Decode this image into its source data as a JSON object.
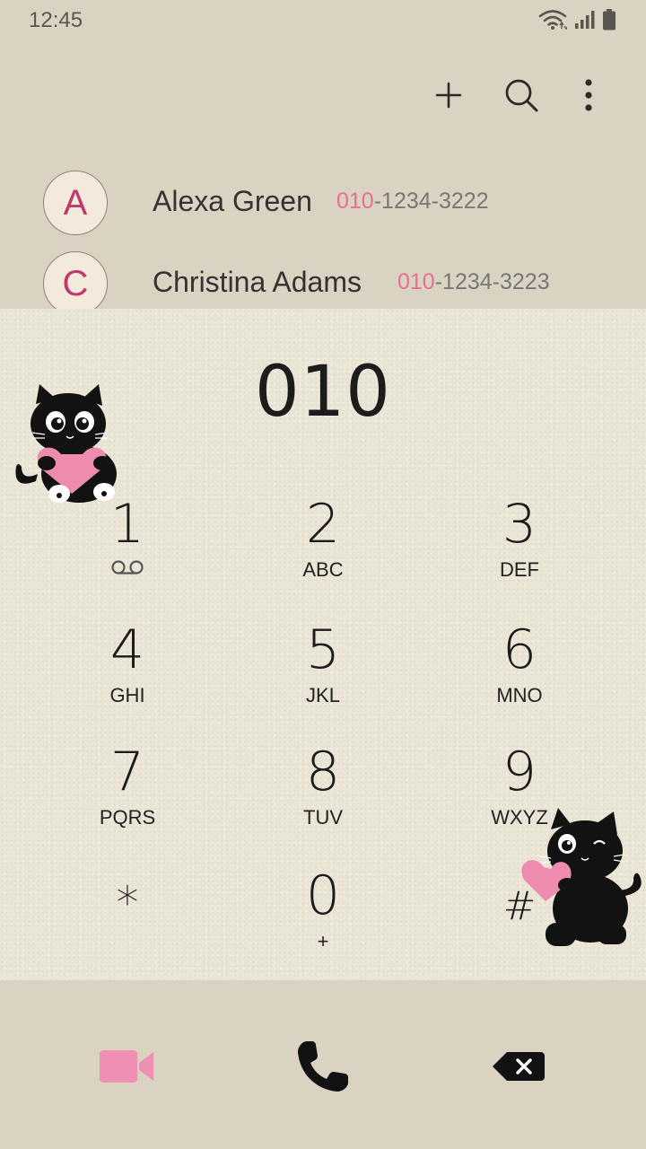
{
  "status_bar": {
    "time": "12:45"
  },
  "contacts": [
    {
      "initial": "A",
      "name": "Alexa Green",
      "number_match": "010",
      "number_rest": "-1234-3222"
    },
    {
      "initial": "C",
      "name": "Christina Adams",
      "number_match": "010",
      "number_rest": "-1234-3223"
    }
  ],
  "dialer": {
    "number": "010",
    "keys": [
      {
        "digit": "1",
        "letters": ""
      },
      {
        "digit": "2",
        "letters": "ABC"
      },
      {
        "digit": "3",
        "letters": "DEF"
      },
      {
        "digit": "4",
        "letters": "GHI"
      },
      {
        "digit": "5",
        "letters": "JKL"
      },
      {
        "digit": "6",
        "letters": "MNO"
      },
      {
        "digit": "7",
        "letters": "PQRS"
      },
      {
        "digit": "8",
        "letters": "TUV"
      },
      {
        "digit": "9",
        "letters": "WXYZ"
      },
      {
        "digit": "*",
        "letters": ""
      },
      {
        "digit": "0",
        "letters": "+"
      },
      {
        "digit": "#",
        "letters": ""
      }
    ]
  },
  "icons": {
    "voicemail": "voicemail-icon",
    "video_call": "video-camera-icon",
    "call": "phone-icon",
    "backspace": "backspace-icon",
    "add": "plus-icon",
    "search": "search-icon",
    "more": "more-vertical-icon"
  },
  "colors": {
    "accent_pink": "#e8708f",
    "avatar_letter": "#c0386c",
    "background": "#dbd3c1"
  }
}
